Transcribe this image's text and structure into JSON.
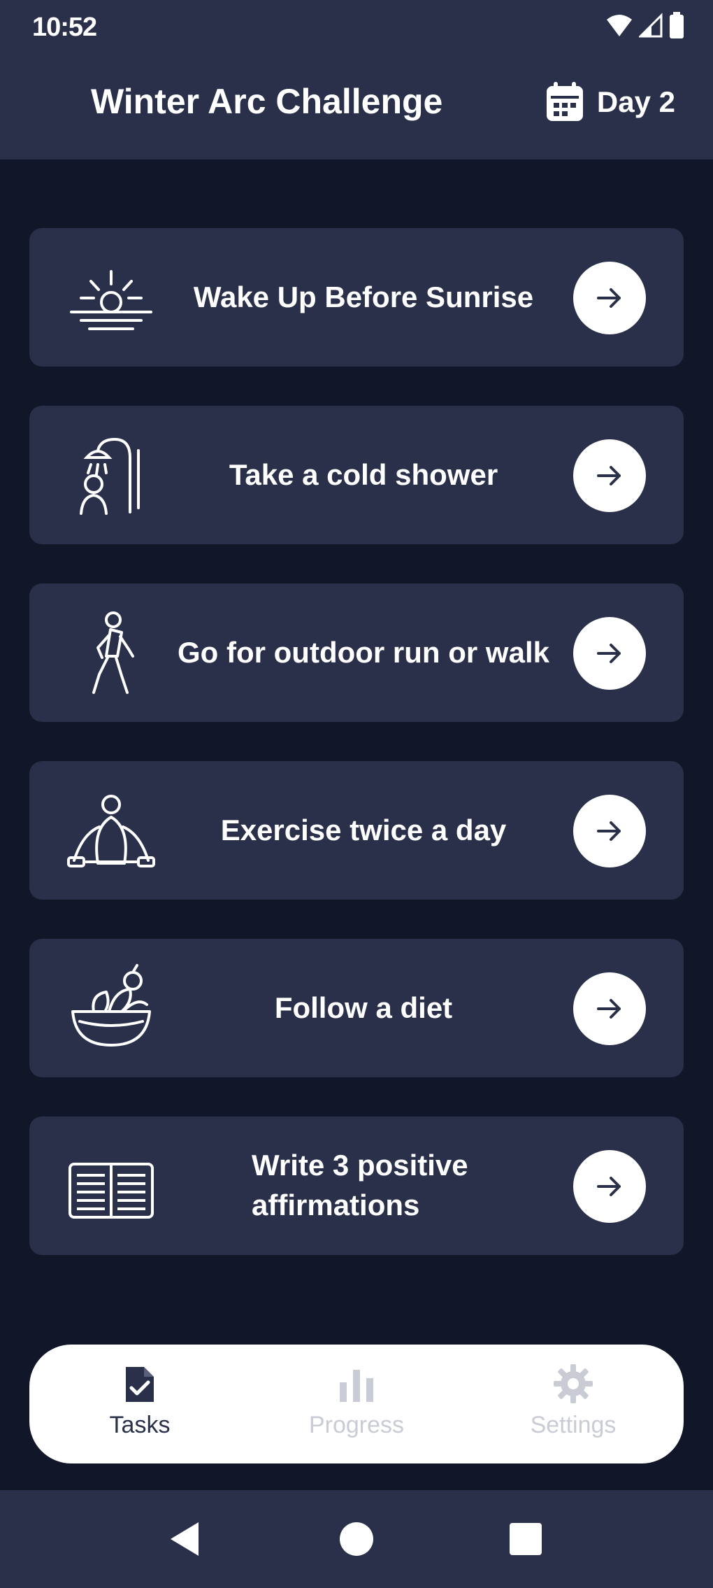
{
  "status_bar": {
    "time": "10:52"
  },
  "app_bar": {
    "title": "Winter Arc Challenge",
    "day_label": "Day 2"
  },
  "tasks": [
    {
      "label": "Wake Up Before Sunrise",
      "icon": "sunrise-icon"
    },
    {
      "label": "Take a cold shower",
      "icon": "shower-icon"
    },
    {
      "label": "Go for outdoor run or walk",
      "icon": "walking-icon"
    },
    {
      "label": "Exercise twice a day",
      "icon": "exercise-icon"
    },
    {
      "label": "Follow a diet",
      "icon": "salad-bowl-icon"
    },
    {
      "label": "Write 3 positive affirmations",
      "icon": "book-icon"
    }
  ],
  "bottom_nav": {
    "items": [
      {
        "label": "Tasks",
        "icon": "clipboard-check-icon",
        "active": true
      },
      {
        "label": "Progress",
        "icon": "bar-chart-icon",
        "active": false
      },
      {
        "label": "Settings",
        "icon": "gear-icon",
        "active": false
      }
    ]
  },
  "colors": {
    "background": "#111729",
    "card": "#2a3049",
    "text": "#ffffff",
    "nav_inactive": "#c9ccd5"
  }
}
